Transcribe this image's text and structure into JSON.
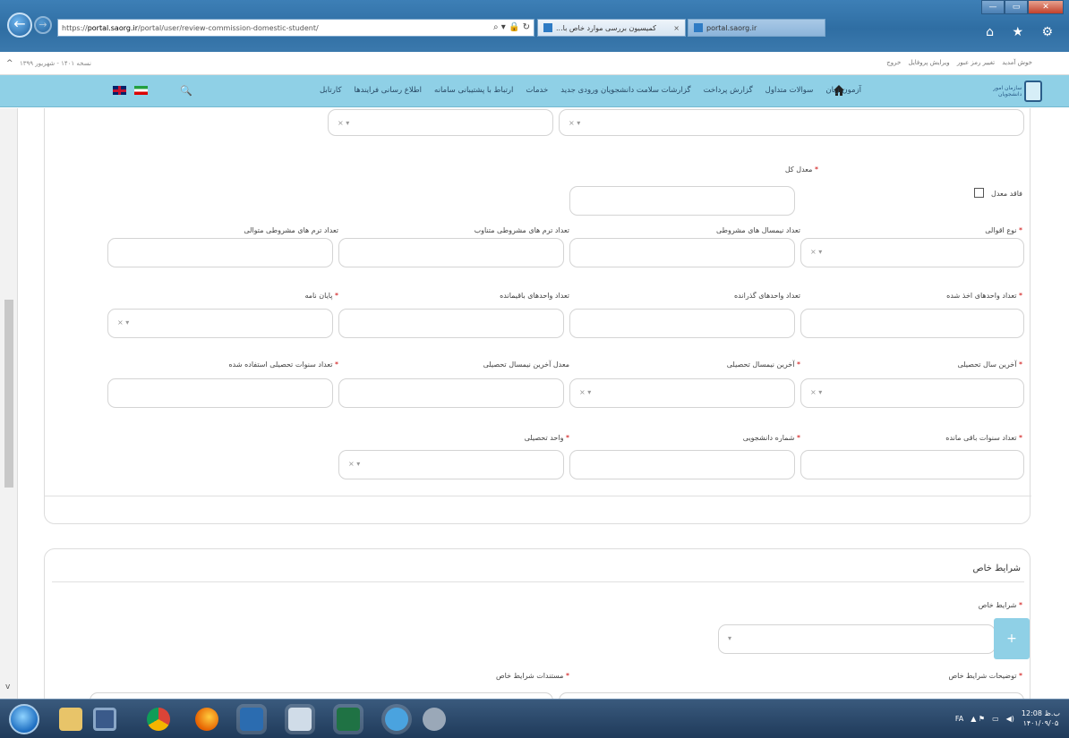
{
  "browser": {
    "url_prefix": "https://",
    "url_host": "portal.saorg.ir",
    "url_path": "/portal/user/review-commission-domestic-student/",
    "tabs": [
      {
        "label": "...کمیسیون بررسی موارد خاص با"
      },
      {
        "label": "portal.saorg.ir"
      }
    ],
    "window_controls": [
      "—",
      "▭",
      "✕"
    ],
    "toolbar_icons": "⌂ ★ ⚙"
  },
  "linkbar": {
    "left_text": "نسخه ۱۴۰۱ - شهریور ۱۳۹۹",
    "user_links": [
      "خوش آمدید",
      "تغییر رمز عبور",
      "ویرایش پروفایل",
      "خروج"
    ]
  },
  "sitenav": {
    "logo_text": "سازمان امور دانشجویان",
    "menu": [
      "کارتابل",
      "اطلاع رسانی فرایندها",
      "ارتباط با پشتیبانی سامانه",
      "خدمات",
      "گزارشات سلامت دانشجویان ورودی جدید",
      "گزارش پرداخت",
      "سوالات متداول",
      "آزمون زبان"
    ]
  },
  "form": {
    "gpa_total_label": "معدل کل",
    "no_gpa_label": "فاقد معدل",
    "course_type_label": "نوع اقوالی",
    "conditional_semesters_label": "تعداد نیمسال های مشروطی",
    "nonconsecutive_label": "تعداد ترم های مشروطی متناوب",
    "consecutive_label": "تعداد ترم های مشروطی متوالی",
    "units_taken_label": "تعداد واحدهای اخذ شده",
    "units_passed_label": "تعداد واحدهای گذرانده",
    "units_remaining_label": "تعداد واحدهای باقیمانده",
    "thesis_label": "پایان نامه",
    "last_year_label": "آخرین سال تحصیلی",
    "last_semester_label": "آخرین نیمسال تحصیلی",
    "last_semester_gpa_label": "معدل آخرین نیمسال تحصیلی",
    "years_used_label": "تعداد سنوات تحصیلی استفاده شده",
    "years_remaining_label": "تعداد سنوات باقی مانده",
    "student_id_label": "شماره دانشجویی",
    "unit_label": "واحد تحصیلی",
    "clear_mark": "× ▾"
  },
  "special": {
    "title": "شرایط خاص",
    "condition_label": "شرایط خاص",
    "add_button": "+",
    "description_label": "توضیحات شرایط خاص",
    "documents_label": "مستندات شرایط خاص"
  },
  "taskbar": {
    "apps": [
      "explorer",
      "media",
      "chrome",
      "firefox",
      "lync",
      "paint",
      "excel",
      "ie",
      "ftp"
    ],
    "tray_lang": "FA",
    "clock_time": "12:08 ب.ظ",
    "clock_date": "۱۴۰۱/۰۹/۰۵"
  }
}
